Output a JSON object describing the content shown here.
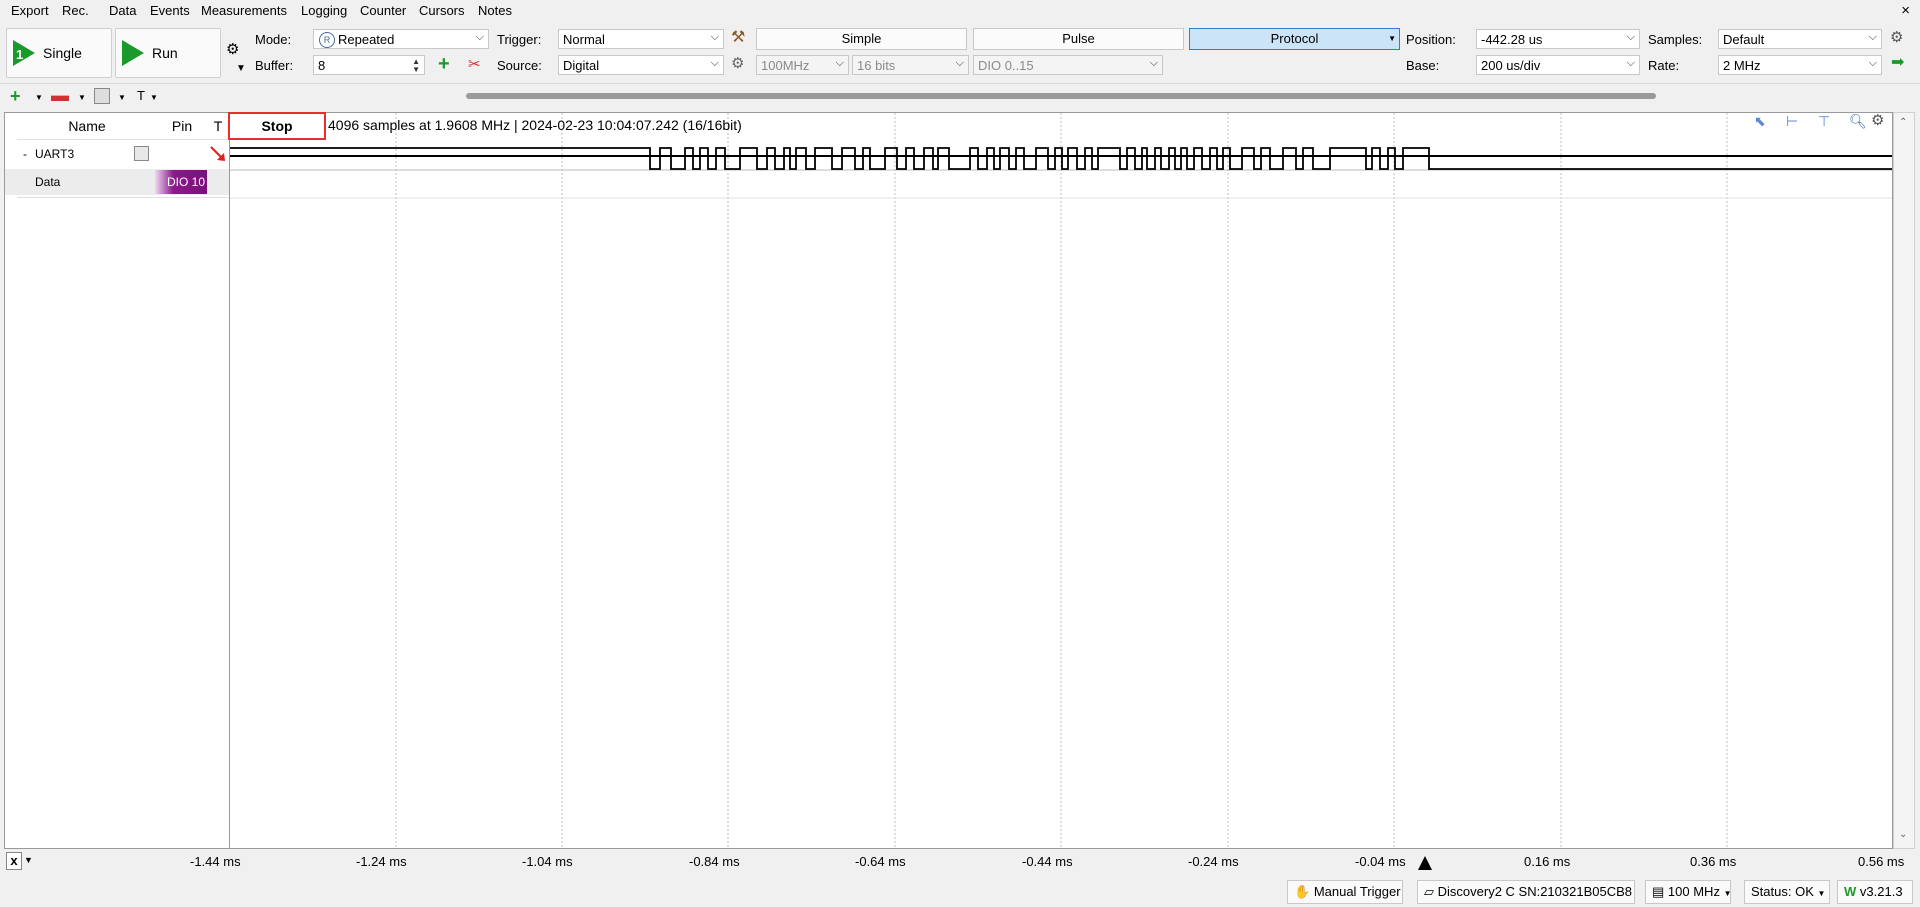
{
  "menu": [
    "Export",
    "Rec.",
    "Data",
    "Events",
    "Measurements",
    "Logging",
    "Counter",
    "Cursors",
    "Notes"
  ],
  "window_close": "×",
  "toolbar": {
    "single_label": "Single",
    "run_label": "Run",
    "mode_label": "Mode:",
    "mode_value": "Repeated",
    "buffer_label": "Buffer:",
    "buffer_value": "8",
    "trigger_label": "Trigger:",
    "trigger_value": "Normal",
    "source_label": "Source:",
    "source_value": "Digital",
    "rate_100": "100MHz",
    "bits": "16 bits",
    "dio_range": "DIO 0..15",
    "tabs": [
      "Simple",
      "Pulse",
      "Protocol"
    ],
    "position_label": "Position:",
    "position_value": "-442.28 us",
    "base_label": "Base:",
    "base_value": "200 us/div",
    "samples_label": "Samples:",
    "samples_value": "Default",
    "rate_label": "Rate:",
    "rate_value": "2 MHz"
  },
  "toolbar2": {
    "t_label": "T"
  },
  "channels": {
    "headers": {
      "name": "Name",
      "pin": "Pin",
      "t": "T"
    },
    "rows": [
      {
        "expander": "-",
        "name": "UART3",
        "pin": ""
      },
      {
        "expander": "",
        "name": "Data",
        "pin": "DIO 10"
      }
    ]
  },
  "plot": {
    "stop_label": "Stop",
    "info": "4096 samples at 1.9608 MHz | 2024-02-23 10:04:07.242 (16/16bit)"
  },
  "time_axis": {
    "x_button": "x",
    "ticks": [
      "-1.44 ms",
      "-1.24 ms",
      "-1.04 ms",
      "-0.84 ms",
      "-0.64 ms",
      "-0.44 ms",
      "-0.24 ms",
      "-0.04 ms",
      "0.16 ms",
      "0.36 ms",
      "0.56 ms"
    ]
  },
  "status": {
    "manual_trigger": "Manual Trigger",
    "device": "Discovery2 C SN:210321B05CB8",
    "clock": "100 MHz",
    "status": "Status: OK",
    "version": "v3.21.3"
  },
  "colors": {
    "accent": "#2f7fd0",
    "stop_border": "#e03030",
    "pin_bg": "#8b1a8b",
    "run_green": "#1a9a2a"
  }
}
